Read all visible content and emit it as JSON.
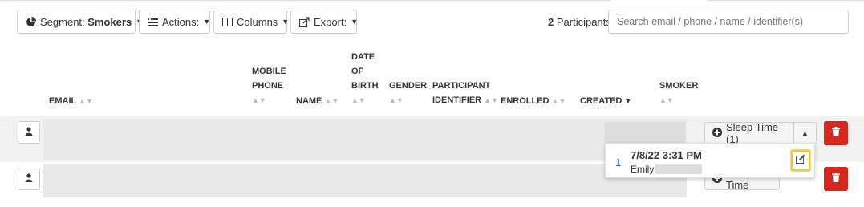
{
  "toolbar": {
    "segment_prefix": "Segment: ",
    "segment_value": "Smokers",
    "actions_label": "Actions:",
    "columns_label": "Columns",
    "export_label": "Export:"
  },
  "participants": {
    "count": "2",
    "count_label": " Participants"
  },
  "search": {
    "placeholder": "Search email / phone / name / identifier(s)"
  },
  "table": {
    "headers": {
      "email": "EMAIL",
      "mobile_phone_1": "MOBILE",
      "mobile_phone_2": "PHONE",
      "name": "NAME",
      "dob_1": "DATE",
      "dob_2": "OF",
      "dob_3": "BIRTH",
      "gender": "GENDER",
      "participant_id_1": "PARTICIPANT",
      "participant_id_2": "IDENTIFIER",
      "enrolled": "ENROLLED",
      "created": "CREATED",
      "smoker": "SMOKER"
    },
    "sort_column": "CREATED",
    "sort_direction": "descending"
  },
  "rows": [
    {
      "action_label": "Sleep Time (1)"
    },
    {
      "action_label": "Sleep Time"
    }
  ],
  "popup": {
    "index": "1",
    "datetime": "7/8/22 3:31 PM",
    "author": "Emily"
  },
  "icons": {
    "segment": "pie-chart-icon",
    "actions": "list-icon",
    "columns": "columns-icon",
    "export": "export-icon",
    "user": "user-icon",
    "delete": "trash-icon",
    "add": "plus-circle-icon",
    "collapse": "caret-up-icon",
    "edit": "edit-icon"
  },
  "colors": {
    "delete": "#d9261c",
    "highlight": "#f2c530",
    "link": "#2a6cb0",
    "row_bg": "#f2f2f2"
  }
}
